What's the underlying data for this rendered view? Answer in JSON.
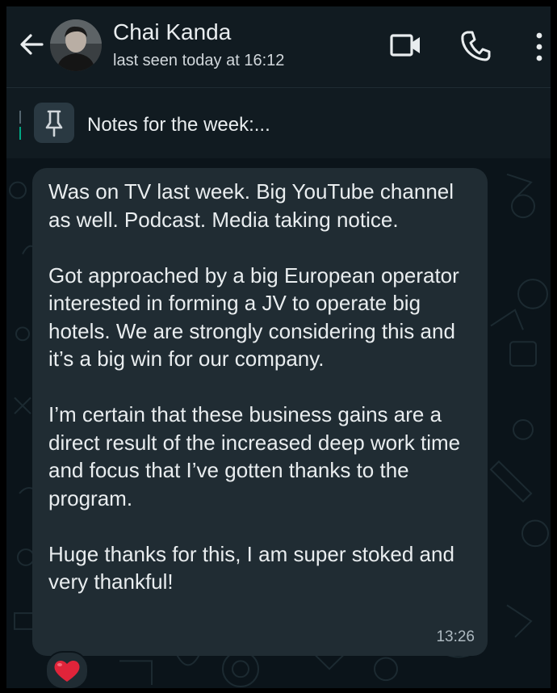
{
  "header": {
    "back_icon": "arrow-left-icon",
    "contact_name": "Chai Kanda",
    "contact_status": "last seen today at 16:12",
    "video_icon": "video-camera-icon",
    "call_icon": "phone-icon",
    "menu_icon": "kebab-menu-icon"
  },
  "pinned": {
    "icon": "pin-icon",
    "text": "Notes for the week:..."
  },
  "message": {
    "paragraphs": [
      "Was on TV last week.   Big YouTube channel as well.  Podcast.  Media taking notice.",
      "Got approached by a big European operator interested in forming a JV to operate big hotels.  We are strongly considering this and it’s a big win for our company.",
      "I’m certain that these business gains are a direct result of the increased deep work time and focus that I’ve gotten thanks to the program.",
      "Huge thanks for this, I am super stoked and very thankful!"
    ],
    "time": "13:26",
    "reaction_icon": "red-heart-icon"
  },
  "colors": {
    "background": "#0b141a",
    "header": "#111b21",
    "bubble": "#202c33",
    "accent": "#00a884",
    "text_primary": "#e9edef",
    "text_secondary": "#aebac1"
  }
}
